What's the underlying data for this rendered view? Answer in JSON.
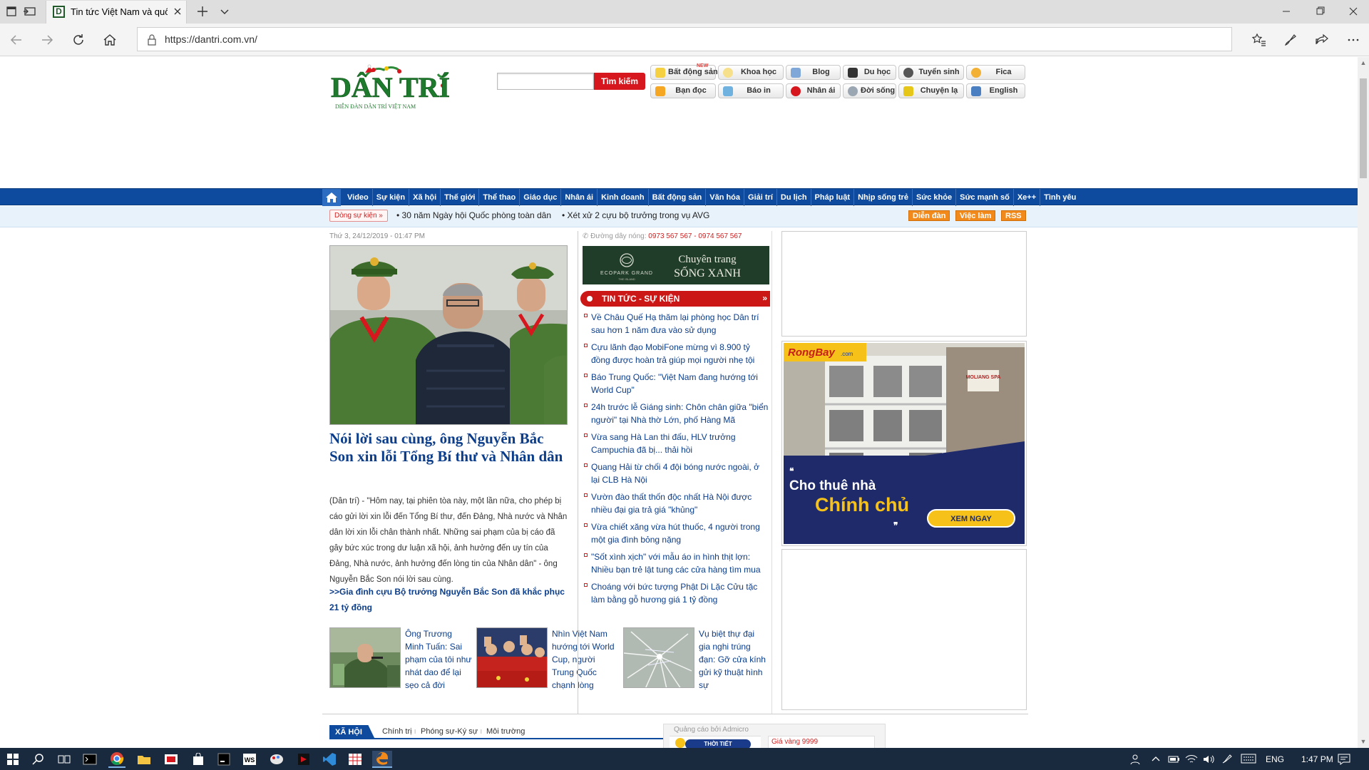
{
  "browser": {
    "tab_title": "Tin tức Việt Nam và quố",
    "url": "https://dantri.com.vn/"
  },
  "header": {
    "logo_text": "DÂN TRÍ",
    "logo_sub": "DIỄN ĐÀN DÂN TRÍ VIỆT NAM",
    "search_button": "Tìm kiếm",
    "quick_links_row1": [
      {
        "label": "Bất động sản",
        "icon": "house-icon",
        "new": "NEW"
      },
      {
        "label": "Khoa học",
        "icon": "bulb-icon"
      },
      {
        "label": "Blog",
        "icon": "people-icon"
      },
      {
        "label": "Du học",
        "icon": "graduate-icon"
      },
      {
        "label": "Tuyển sinh",
        "icon": "student-icon"
      },
      {
        "label": "Fica",
        "icon": "coin-icon"
      }
    ],
    "quick_links_row2": [
      {
        "label": "Bạn đọc",
        "icon": "pen-icon"
      },
      {
        "label": "Báo in",
        "icon": "newspaper-icon"
      },
      {
        "label": "Nhân ái",
        "icon": "heart-icon"
      },
      {
        "label": "Đời sống",
        "icon": "clock-icon"
      },
      {
        "label": "Chuyện lạ",
        "icon": "star-icon"
      },
      {
        "label": "English",
        "icon": "book-icon"
      }
    ]
  },
  "nav": {
    "items": [
      "Video",
      "Sự kiện",
      "Xã hội",
      "Thế giới",
      "Thể thao",
      "Giáo dục",
      "Nhân ái",
      "Kinh doanh",
      "Bất động sản",
      "Văn hóa",
      "Giải trí",
      "Du lịch",
      "Pháp luật",
      "Nhịp sống trẻ",
      "Sức khỏe",
      "Sức mạnh số",
      "Xe++",
      "Tình yêu"
    ]
  },
  "subbar": {
    "badge": "Dòng sự kiện »",
    "events": [
      "30 năm Ngày hội Quốc phòng toàn dân",
      "Xét xử 2 cựu bộ trưởng trong vụ AVG"
    ],
    "buttons": [
      "Diễn đàn",
      "Việc làm",
      "RSS"
    ]
  },
  "main": {
    "dateline": "Thứ 3, 24/12/2019 - 01:47 PM",
    "hero_title": "Nói lời sau cùng, ông Nguyễn Bắc Son xin lỗi Tổng Bí thư và Nhân dân",
    "hero_summary": "(Dân trí) - \"Hôm nay, tại phiên tòa này, một lần nữa, cho phép bị cáo gửi lời xin lỗi đến Tổng Bí thư, đến Đảng, Nhà nước và Nhân dân lời xin lỗi chân thành nhất. Những sai phạm của bị cáo đã gây bức xúc trong dư luận xã hội, ảnh hưởng đến uy tín của Đảng, Nhà nước, ảnh hưởng đến lòng tin của Nhân dân\" - ông Nguyễn Bắc Son nói lời sau cùng.",
    "hero_related": ">>Gia đình cựu Bộ trưởng Nguyễn Bắc Son đã khắc phục 21 tỷ đồng",
    "thumbs": [
      "Ông Trương Minh Tuấn: Sai phạm của tôi như nhát dao để lại sẹo cả đời",
      "Nhìn Việt Nam hướng tới World Cup, người Trung Quốc chạnh lòng",
      "Vụ biệt thự đại gia nghi trúng đạn: Gỡ cửa kính gửi kỹ thuật hình sự"
    ]
  },
  "middle": {
    "hotline_label": "Đường dây nóng:",
    "hotline_numbers": "0973 567 567 - 0974 567 567",
    "banner_line1": "Chuyên trang",
    "banner_line2": "SỐNG XANH",
    "banner_brand": "ECOPARK GRAND",
    "banner_brand_sub": "THE ISLAND",
    "section_title": "TIN TỨC - SỰ KIỆN",
    "news": [
      "Về Châu Quế Hạ thăm lại phòng học Dân trí sau hơn 1 năm đưa vào sử dụng",
      "Cựu lãnh đạo MobiFone mừng vì 8.900 tỷ đồng được hoàn trả giúp mọi người nhẹ tội",
      "Báo Trung Quốc: \"Việt Nam đang hướng tới World Cup\"",
      "24h trước lễ Giáng sinh: Chôn chân giữa \"biển người\" tại Nhà thờ Lớn, phố Hàng Mã",
      "Vừa sang Hà Lan thi đấu, HLV trưởng Campuchia đã bị... thải hồi",
      "Quang Hải từ chối 4 đội bóng nước ngoài, ở lại CLB Hà Nội",
      "Vườn đào thất thốn độc nhất Hà Nội được nhiều đại gia trả giá \"khủng\"",
      "Vừa chiết xăng vừa hút thuốc, 4 người trong một gia đình bỏng nặng",
      "\"Sốt xình xịch\" với mẫu áo in hình thịt lợn: Nhiều bạn trẻ lật tung các cửa hàng tìm mua",
      "Choáng với bức tượng Phật Di Lặc Cửu tặc làm bằng gỗ hương giá 1 tỷ đồng"
    ]
  },
  "ads": {
    "rongbay_logo": "RongBay",
    "rongbay_logo_suffix": ".com",
    "rongbay_line1": "Cho thuê nhà",
    "rongbay_line2": "Chính chủ",
    "rongbay_cta": "XEM NGAY",
    "shop_sign": "MOLIANG SPA"
  },
  "bottom": {
    "section_tag": "XÃ HỘI",
    "subsections": [
      "Chính trị",
      "Phóng sự-Ký sự",
      "Môi trường"
    ],
    "admicro_label": "Quảng cáo bởi Admicro",
    "admicro_text1": "THỜI TIẾT",
    "admicro_text2": "Giá vàng 9999"
  },
  "taskbar": {
    "lang": "ENG",
    "time": "1:47 PM"
  },
  "colors": {
    "nav_blue": "#0e4a9e",
    "accent_red": "#d7171e",
    "link_blue": "#0b3d8a",
    "taskbar": "#1a2a3e"
  }
}
